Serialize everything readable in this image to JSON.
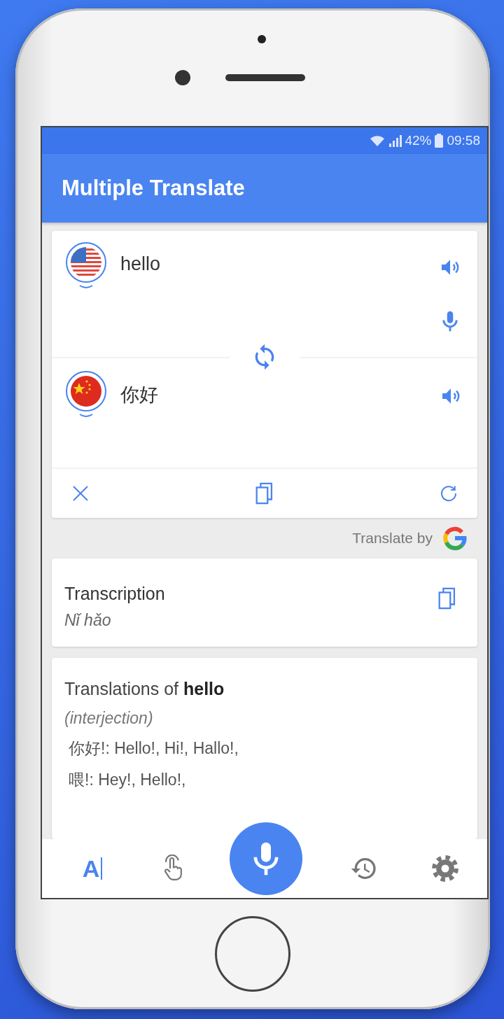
{
  "status_bar": {
    "battery": "42%",
    "time": "09:58"
  },
  "app_bar": {
    "title": "Multiple Translate"
  },
  "source": {
    "kind": "us",
    "text": "hello"
  },
  "target": {
    "kind": "cn",
    "text": "你好"
  },
  "attribution": {
    "label": "Translate by"
  },
  "transcription": {
    "title": "Transcription",
    "text": "Nǐ hǎo"
  },
  "translations": {
    "title": "Translations of **hello**",
    "part_of_speech": "(interjection)",
    "lines": [
      "你好!: Hello!, Hi!, Hallo!,",
      "喂!: Hey!, Hello!,"
    ]
  },
  "nav": [
    {
      "kind": "text",
      "label": "A",
      "selected": true
    },
    {
      "kind": "gesture",
      "selected": false
    },
    {
      "kind": "history",
      "selected": false
    },
    {
      "kind": "settings",
      "selected": false
    }
  ]
}
